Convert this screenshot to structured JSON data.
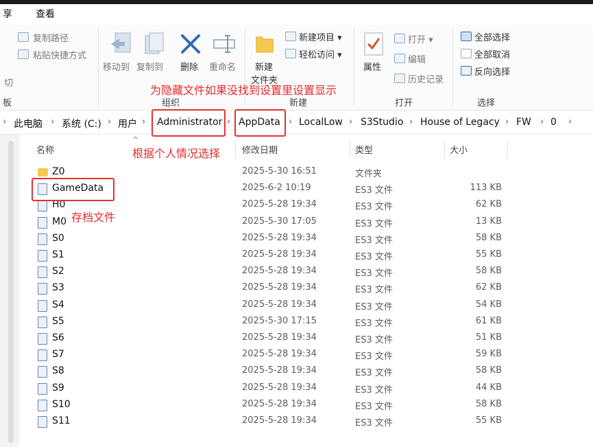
{
  "menu": {
    "share": "享",
    "view": "查看"
  },
  "ribbon": {
    "copy_path": "复制路径",
    "paste_shortcut": "粘贴快捷方式",
    "cut_partial": "切",
    "board_partial": "板",
    "move_to": "移动到",
    "copy_to": "复制到",
    "delete": "删除",
    "rename": "重命名",
    "organize": "组织",
    "new_folder_1": "新建",
    "new_folder_2": "文件夹",
    "new_item": "新建项目",
    "easy_access": "轻松访问",
    "new_group": "新建",
    "properties": "属性",
    "open": "打开",
    "edit": "编辑",
    "history": "历史记录",
    "open_group": "打开",
    "select_all": "全部选择",
    "select_none": "全部取消",
    "invert": "反向选择",
    "select_group": "选择"
  },
  "breadcrumb": [
    "此电脑",
    "系统 (C:)",
    "用户",
    "Administrator",
    "AppData",
    "LocalLow",
    "S3Studio",
    "House of Legacy",
    "FW",
    "0"
  ],
  "columns": {
    "name": "名称",
    "date": "修改日期",
    "type": "类型",
    "size": "大小"
  },
  "annotations": {
    "top": "为隐藏文件如果没找到设置里设置显示",
    "middle": "根据个人情况选择",
    "save": "存档文件"
  },
  "files": [
    {
      "name": "Z0",
      "date": "2025-5-30 16:51",
      "type": "文件夹",
      "size": "",
      "icon": "folder"
    },
    {
      "name": "GameData",
      "date": "2025-6-2 10:19",
      "type": "ES3 文件",
      "size": "113 KB",
      "icon": "file"
    },
    {
      "name": "H0",
      "date": "2025-5-28 19:34",
      "type": "ES3 文件",
      "size": "62 KB",
      "icon": "file"
    },
    {
      "name": "M0",
      "date": "2025-5-30 17:05",
      "type": "ES3 文件",
      "size": "13 KB",
      "icon": "file"
    },
    {
      "name": "S0",
      "date": "2025-5-28 19:34",
      "type": "ES3 文件",
      "size": "58 KB",
      "icon": "file"
    },
    {
      "name": "S1",
      "date": "2025-5-28 19:34",
      "type": "ES3 文件",
      "size": "55 KB",
      "icon": "file"
    },
    {
      "name": "S2",
      "date": "2025-5-28 19:34",
      "type": "ES3 文件",
      "size": "58 KB",
      "icon": "file"
    },
    {
      "name": "S3",
      "date": "2025-5-28 19:34",
      "type": "ES3 文件",
      "size": "62 KB",
      "icon": "file"
    },
    {
      "name": "S4",
      "date": "2025-5-28 19:34",
      "type": "ES3 文件",
      "size": "54 KB",
      "icon": "file"
    },
    {
      "name": "S5",
      "date": "2025-5-30 17:15",
      "type": "ES3 文件",
      "size": "61 KB",
      "icon": "file"
    },
    {
      "name": "S6",
      "date": "2025-5-28 19:34",
      "type": "ES3 文件",
      "size": "51 KB",
      "icon": "file"
    },
    {
      "name": "S7",
      "date": "2025-5-28 19:34",
      "type": "ES3 文件",
      "size": "59 KB",
      "icon": "file"
    },
    {
      "name": "S8",
      "date": "2025-5-28 19:34",
      "type": "ES3 文件",
      "size": "58 KB",
      "icon": "file"
    },
    {
      "name": "S9",
      "date": "2025-5-28 19:34",
      "type": "ES3 文件",
      "size": "44 KB",
      "icon": "file"
    },
    {
      "name": "S10",
      "date": "2025-5-28 19:34",
      "type": "ES3 文件",
      "size": "58 KB",
      "icon": "file"
    },
    {
      "name": "S11",
      "date": "2025-5-28 19:34",
      "type": "ES3 文件",
      "size": "55 KB",
      "icon": "file"
    }
  ],
  "colors": {
    "annotation": "#e23232",
    "folder": "#f6c94d"
  }
}
